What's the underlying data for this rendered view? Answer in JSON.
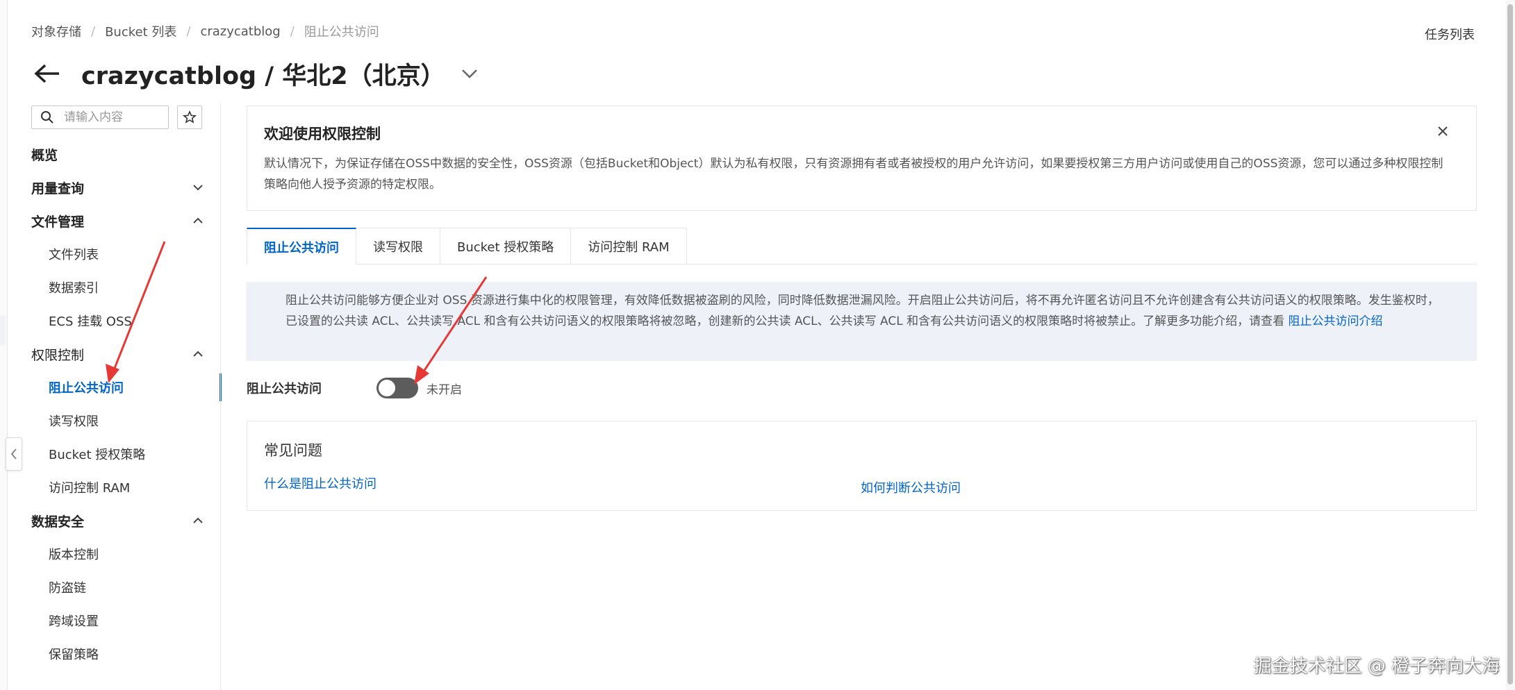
{
  "breadcrumb": [
    "对象存储",
    "Bucket 列表",
    "crazycatblog",
    "阻止公共访问"
  ],
  "task_list_label": "任务列表",
  "page_title": "crazycatblog / 华北2（北京）",
  "sidebar": {
    "search_placeholder": "请输入内容",
    "overview": "概览",
    "usage": "用量查询",
    "file_mgmt": {
      "label": "文件管理",
      "items": [
        "文件列表",
        "数据索引",
        "ECS 挂载 OSS"
      ]
    },
    "access_control": {
      "label": "权限控制",
      "items": [
        "阻止公共访问",
        "读写权限",
        "Bucket 授权策略",
        "访问控制 RAM"
      ]
    },
    "data_security": {
      "label": "数据安全",
      "items": [
        "版本控制",
        "防盗链",
        "跨域设置",
        "保留策略"
      ]
    }
  },
  "welcome": {
    "title": "欢迎使用权限控制",
    "description": "默认情况下，为保证存储在OSS中数据的安全性，OSS资源（包括Bucket和Object）默认为私有权限，只有资源拥有者或者被授权的用户允许访问，如果要授权第三方用户访问或使用自己的OSS资源，您可以通过多种权限控制策略向他人授予资源的特定权限。"
  },
  "tabs": [
    "阻止公共访问",
    "读写权限",
    "Bucket 授权策略",
    "访问控制 RAM"
  ],
  "notice": {
    "text": "阻止公共访问能够方便企业对 OSS 资源进行集中化的权限管理，有效降低数据被盗刷的风险，同时降低数据泄漏风险。开启阻止公共访问后，将不再允许匿名访问且不允许创建含有公共访问语义的权限策略。发生鉴权时，已设置的公共读 ACL、公共读写 ACL 和含有公共访问语义的权限策略将被忽略，创建新的公共读 ACL、公共读写 ACL 和含有公共访问语义的权限策略时将被禁止。了解更多功能介绍，请查看 ",
    "link": "阻止公共访问介绍"
  },
  "toggle": {
    "label": "阻止公共访问",
    "status": "未开启",
    "enabled": false
  },
  "faq": {
    "title": "常见问题",
    "links": [
      "什么是阻止公共访问",
      "如何判断公共访问"
    ]
  },
  "watermark": "掘金技术社区 @ 橙子奔向大海",
  "colors": {
    "accent": "#0064c8",
    "annotation_arrow": "#e53935",
    "toggle_off": "#5c5c5c"
  }
}
